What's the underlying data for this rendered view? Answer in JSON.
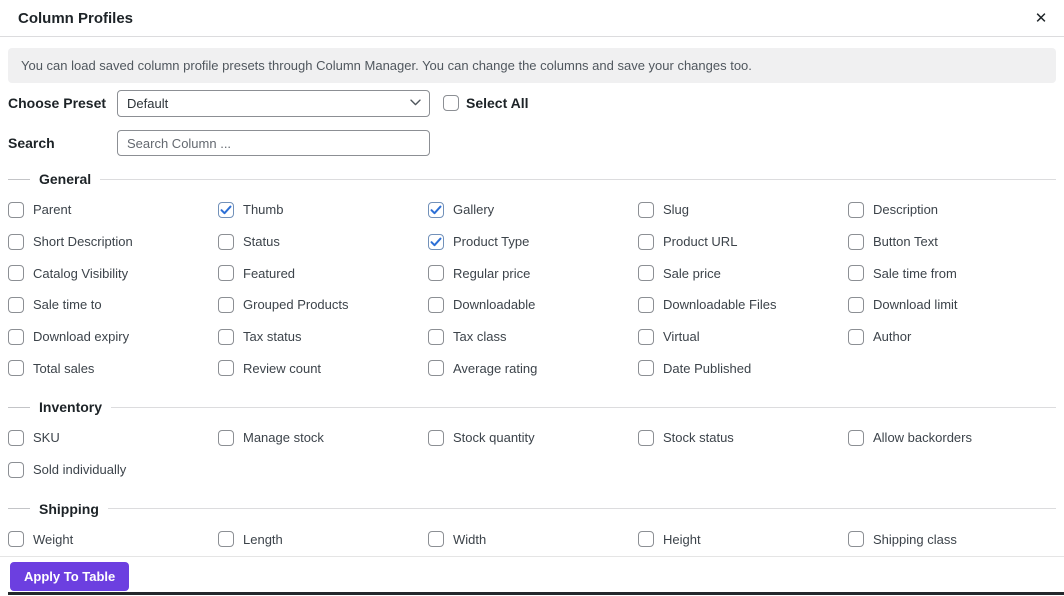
{
  "modal": {
    "title": "Column Profiles",
    "close_icon": "✕"
  },
  "banner": {
    "text": "You can load saved column profile presets through Column Manager. You can change the columns and save your changes too."
  },
  "preset": {
    "label": "Choose Preset",
    "selected": "Default",
    "select_all_label": "Select All",
    "select_all_checked": false
  },
  "search": {
    "label": "Search",
    "placeholder": "Search Column ..."
  },
  "sections": [
    {
      "title": "General",
      "items": [
        {
          "label": "Parent",
          "checked": false
        },
        {
          "label": "Thumb",
          "checked": true
        },
        {
          "label": "Gallery",
          "checked": true
        },
        {
          "label": "Slug",
          "checked": false
        },
        {
          "label": "Description",
          "checked": false
        },
        {
          "label": "Short Description",
          "checked": false
        },
        {
          "label": "Status",
          "checked": false
        },
        {
          "label": "Product Type",
          "checked": true
        },
        {
          "label": "Product URL",
          "checked": false
        },
        {
          "label": "Button Text",
          "checked": false
        },
        {
          "label": "Catalog Visibility",
          "checked": false
        },
        {
          "label": "Featured",
          "checked": false
        },
        {
          "label": "Regular price",
          "checked": false
        },
        {
          "label": "Sale price",
          "checked": false
        },
        {
          "label": "Sale time from",
          "checked": false
        },
        {
          "label": "Sale time to",
          "checked": false
        },
        {
          "label": "Grouped Products",
          "checked": false
        },
        {
          "label": "Downloadable",
          "checked": false
        },
        {
          "label": "Downloadable Files",
          "checked": false
        },
        {
          "label": "Download limit",
          "checked": false
        },
        {
          "label": "Download expiry",
          "checked": false
        },
        {
          "label": "Tax status",
          "checked": false
        },
        {
          "label": "Tax class",
          "checked": false
        },
        {
          "label": "Virtual",
          "checked": false
        },
        {
          "label": "Author",
          "checked": false
        },
        {
          "label": "Total sales",
          "checked": false
        },
        {
          "label": "Review count",
          "checked": false
        },
        {
          "label": "Average rating",
          "checked": false
        },
        {
          "label": "Date Published",
          "checked": false
        }
      ]
    },
    {
      "title": "Inventory",
      "items": [
        {
          "label": "SKU",
          "checked": false
        },
        {
          "label": "Manage stock",
          "checked": false
        },
        {
          "label": "Stock quantity",
          "checked": false
        },
        {
          "label": "Stock status",
          "checked": false
        },
        {
          "label": "Allow backorders",
          "checked": false
        },
        {
          "label": "Sold individually",
          "checked": false
        }
      ]
    },
    {
      "title": "Shipping",
      "items": [
        {
          "label": "Weight",
          "checked": false
        },
        {
          "label": "Length",
          "checked": false
        },
        {
          "label": "Width",
          "checked": false
        },
        {
          "label": "Height",
          "checked": false
        },
        {
          "label": "Shipping class",
          "checked": false
        }
      ]
    }
  ],
  "footer": {
    "apply_label": "Apply To Table"
  },
  "colors": {
    "accent": "#6c3fe0",
    "check": "#2c6fd6",
    "banner_bg": "#f0f0f1"
  }
}
